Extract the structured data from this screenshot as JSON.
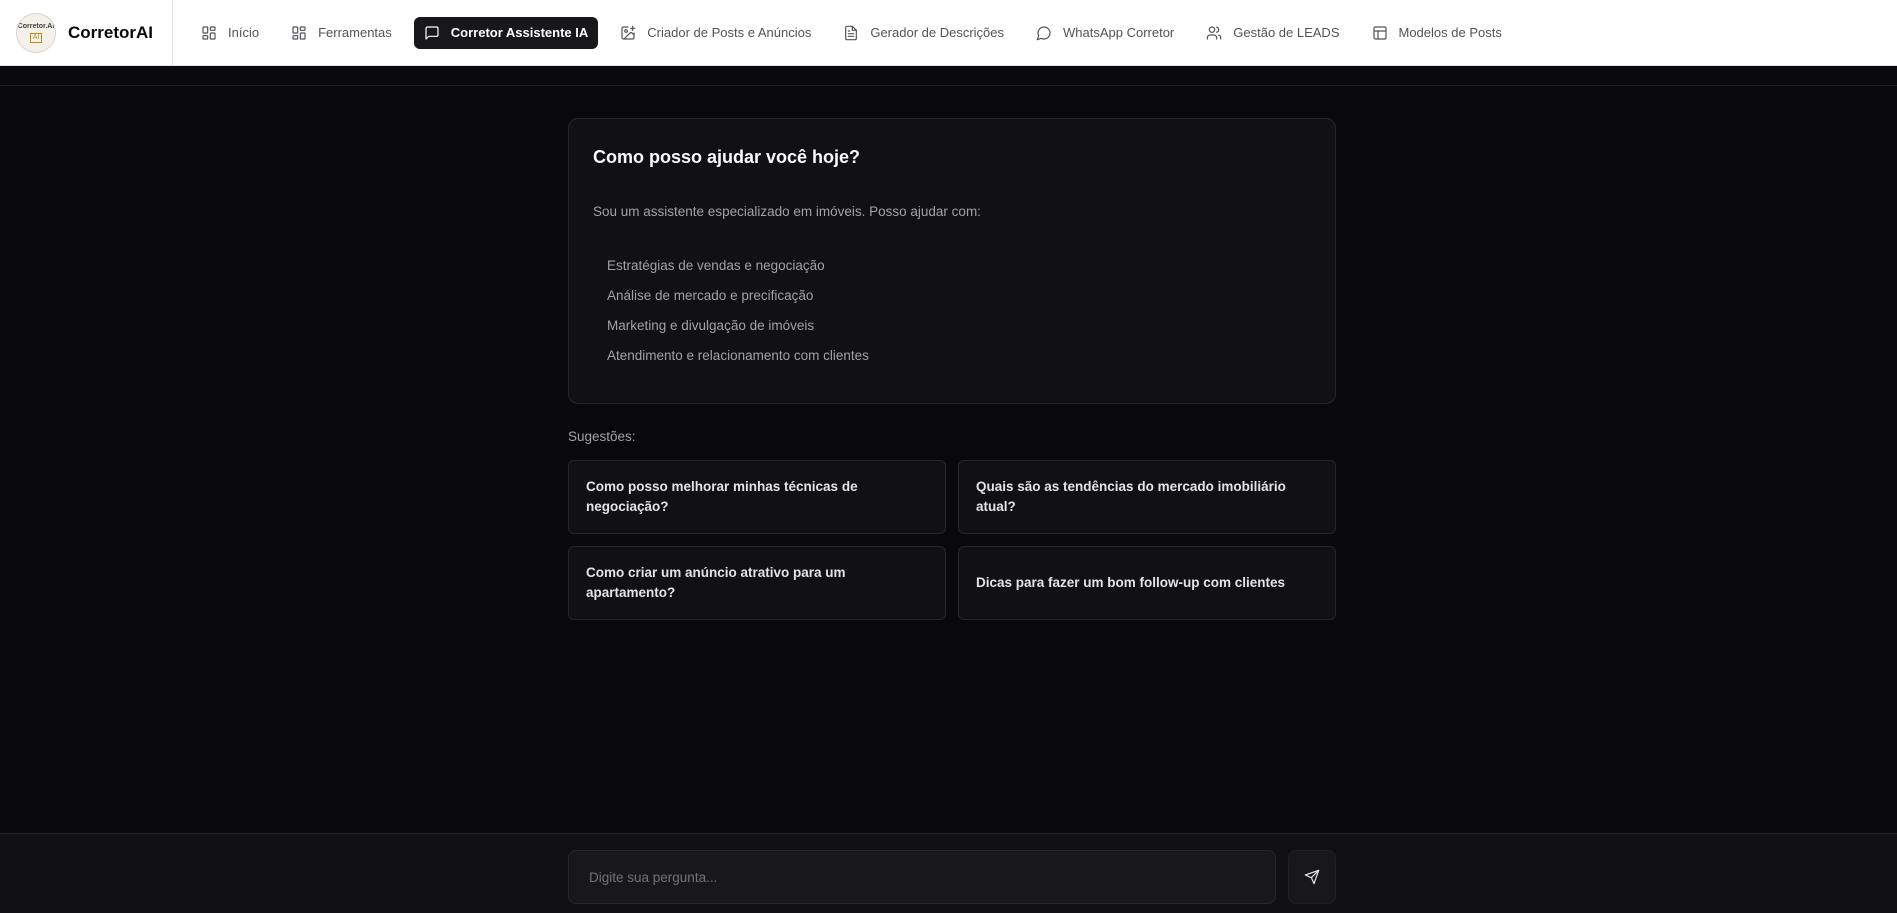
{
  "app": {
    "name": "CorretorAI",
    "logo_text": "Corretor.AI",
    "logo_badge": "AI"
  },
  "nav": {
    "items": [
      {
        "label": "Início",
        "icon": "grid-icon",
        "active": false
      },
      {
        "label": "Ferramentas",
        "icon": "grid-icon",
        "active": false
      },
      {
        "label": "Corretor Assistente IA",
        "icon": "message-square-icon",
        "active": true
      },
      {
        "label": "Criador de Posts e Anúncios",
        "icon": "image-plus-icon",
        "active": false
      },
      {
        "label": "Gerador de Descrições",
        "icon": "file-text-icon",
        "active": false
      },
      {
        "label": "WhatsApp Corretor",
        "icon": "message-circle-icon",
        "active": false
      },
      {
        "label": "Gestão de LEADS",
        "icon": "users-icon",
        "active": false
      },
      {
        "label": "Modelos de Posts",
        "icon": "layout-icon",
        "active": false
      }
    ]
  },
  "intro": {
    "title": "Como posso ajudar você hoje?",
    "description": "Sou um assistente especializado em imóveis. Posso ajudar com:",
    "topics": [
      "Estratégias de vendas e negociação",
      "Análise de mercado e precificação",
      "Marketing e divulgação de imóveis",
      "Atendimento e relacionamento com clientes"
    ]
  },
  "suggestions": {
    "label": "Sugestões:",
    "items": [
      "Como posso melhorar minhas técnicas de negociação?",
      "Quais são as tendências do mercado imobiliário atual?",
      "Como criar um anúncio atrativo para um apartamento?",
      "Dicas para fazer um bom follow-up com clientes"
    ]
  },
  "chat": {
    "placeholder": "Digite sua pergunta...",
    "value": "",
    "send_icon": "send-icon"
  },
  "colors": {
    "background": "#09090b",
    "card": "#111113",
    "border": "#27272a",
    "active_nav": "#18181b",
    "topbar": "#ffffff"
  }
}
